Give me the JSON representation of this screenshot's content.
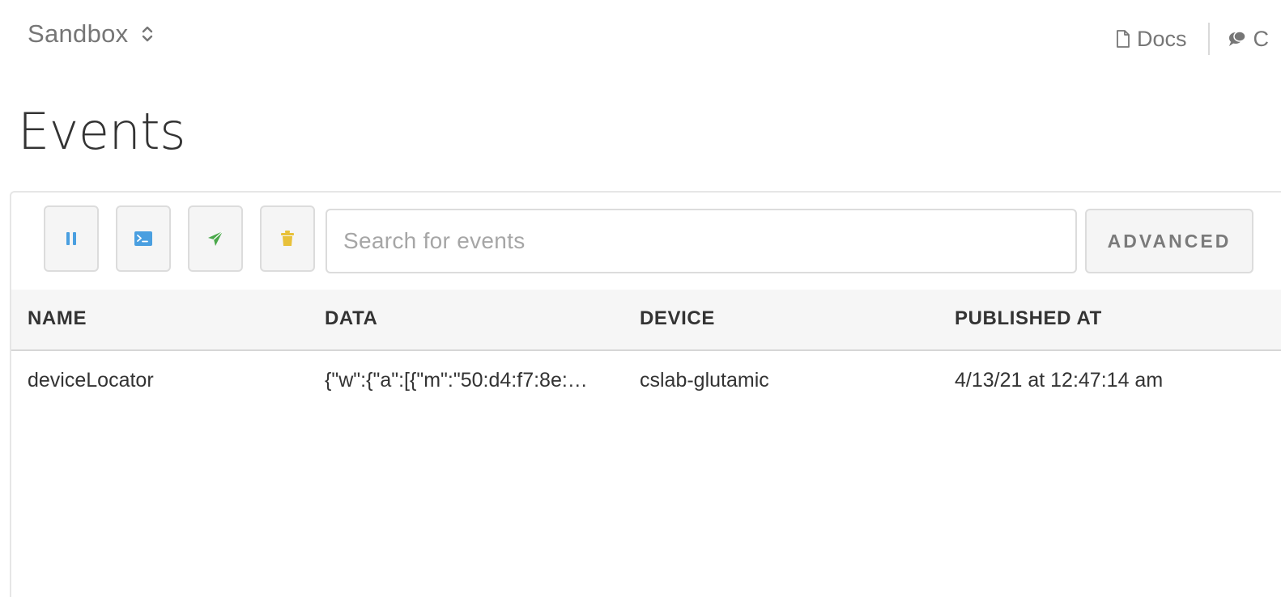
{
  "header": {
    "org_name": "Sandbox",
    "nav": {
      "docs_label": "Docs",
      "community_label": "C"
    }
  },
  "page": {
    "title": "Events"
  },
  "toolbar": {
    "pause_icon": "pause-icon",
    "console_icon": "terminal-icon",
    "publish_icon": "send-icon",
    "clear_icon": "trash-icon",
    "search_placeholder": "Search for events",
    "search_value": "",
    "advanced_label": "ADVANCED"
  },
  "table": {
    "columns": [
      "NAME",
      "DATA",
      "DEVICE",
      "PUBLISHED AT"
    ],
    "rows": [
      {
        "name": "deviceLocator",
        "data": "{\"w\":{\"a\":[{\"m\":\"50:d4:f7:8e:…",
        "device": "cslab-glutamic",
        "published_at": "4/13/21 at 12:47:14 am"
      }
    ]
  },
  "colors": {
    "pause": "#4a9fe0",
    "console": "#4a9fe0",
    "publish": "#4aa84a",
    "clear": "#e8c13a",
    "header_bg": "#f6f6f6"
  }
}
